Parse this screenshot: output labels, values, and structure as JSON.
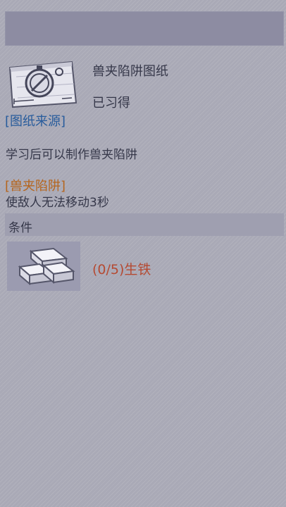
{
  "item": {
    "name": "兽夹陷阱图纸",
    "status": "已习得",
    "icon": "blueprint-compass-icon"
  },
  "source_link": "[图纸来源]",
  "description": "学习后可以制作兽夹陷阱",
  "effect": {
    "title": "[兽夹陷阱]",
    "description": "使敌人无法移动3秒"
  },
  "conditions": {
    "label": "条件",
    "materials": [
      {
        "icon": "iron-ingot-icon",
        "text": "(0/5)生铁"
      }
    ]
  },
  "colors": {
    "background": "#a9a9b6",
    "title_bar": "#8d8ca2",
    "link": "#285c9c",
    "effect_title": "#b5651d",
    "requirement_unmet": "#b54a32",
    "text": "#36384a"
  }
}
